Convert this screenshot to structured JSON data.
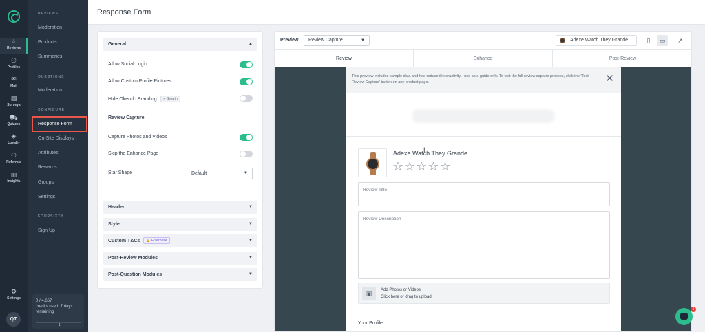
{
  "rail": {
    "items": [
      {
        "icon": "☆",
        "label": "Reviews"
      },
      {
        "icon": "⚇",
        "label": "Profiles"
      },
      {
        "icon": "✉",
        "label": "Mail"
      },
      {
        "icon": "▤",
        "label": "Surveys"
      },
      {
        "icon": "⛟",
        "label": "Quizzes"
      },
      {
        "icon": "◈",
        "label": "Loyalty"
      },
      {
        "icon": "⚇",
        "label": "Referrals"
      },
      {
        "icon": "▥",
        "label": "Insights"
      }
    ],
    "settings_label": "Settings",
    "settings_icon": "⚙",
    "avatar": "QT"
  },
  "subnav": {
    "reviews_title": "REVIEWS",
    "reviews_items": [
      "Moderation",
      "Products",
      "Summaries"
    ],
    "questions_title": "QUESTIONS",
    "questions_items": [
      "Moderation"
    ],
    "configure_title": "CONFIGURE",
    "configure_items": [
      "Response Form",
      "On-Site Displays",
      "Attributes",
      "Rewards",
      "Groups",
      "Settings"
    ],
    "foursixty_title": "FOURSIXTY",
    "foursixty_items": [
      "Sign Up"
    ],
    "credits_line1": "0 / 4,667",
    "credits_line2": "credits used, 7 days",
    "credits_line3": "remaining",
    "credits_num": "1",
    "credits_progress": 0.02
  },
  "header": {
    "title": "Response Form"
  },
  "settings": {
    "general": "General",
    "allow_social_login": "Allow Social Login",
    "allow_custom_pictures": "Allow Custom Profile Pictures",
    "hide_branding": "Hide Okendo Branding",
    "growth_badge": "⚡ Growth",
    "review_capture": "Review Capture",
    "capture_photos": "Capture Photos and Videos",
    "skip_enhance": "Skip the Enhance Page",
    "star_shape": "Star Shape",
    "star_shape_value": "Default",
    "sections": [
      "Header",
      "Style",
      "Custom T&Cs",
      "Post-Review Modules",
      "Post-Question Modules"
    ],
    "enterprise_badge": "🔒 Enterprise",
    "toggles": {
      "social": true,
      "pictures": true,
      "branding": false,
      "photos": true,
      "skip": false
    }
  },
  "preview": {
    "label": "Preview",
    "mode": "Review Capture",
    "product": "Adexe Watch They Grande",
    "tabs": [
      "Review",
      "Enhance",
      "Post-Review"
    ],
    "notice": "This preview includes sample data and has reduced interactivity - use as a guide only. To test the full review capture process, click the 'Test Review Capture' button on any product page.",
    "product_name": "Adexe Watch They Grande",
    "stars": "☆☆☆☆☆",
    "review_title_label": "Review Title",
    "review_desc_label": "Review Description",
    "upload_title": "Add Photos or Videos",
    "upload_sub": "Click here or drag to upload",
    "your_profile": "Your Profile"
  },
  "chat_badge": "1",
  "colors": {
    "accent": "#2bbd8e",
    "sidebar": "#1f2a36",
    "highlight": "#e8574a"
  }
}
